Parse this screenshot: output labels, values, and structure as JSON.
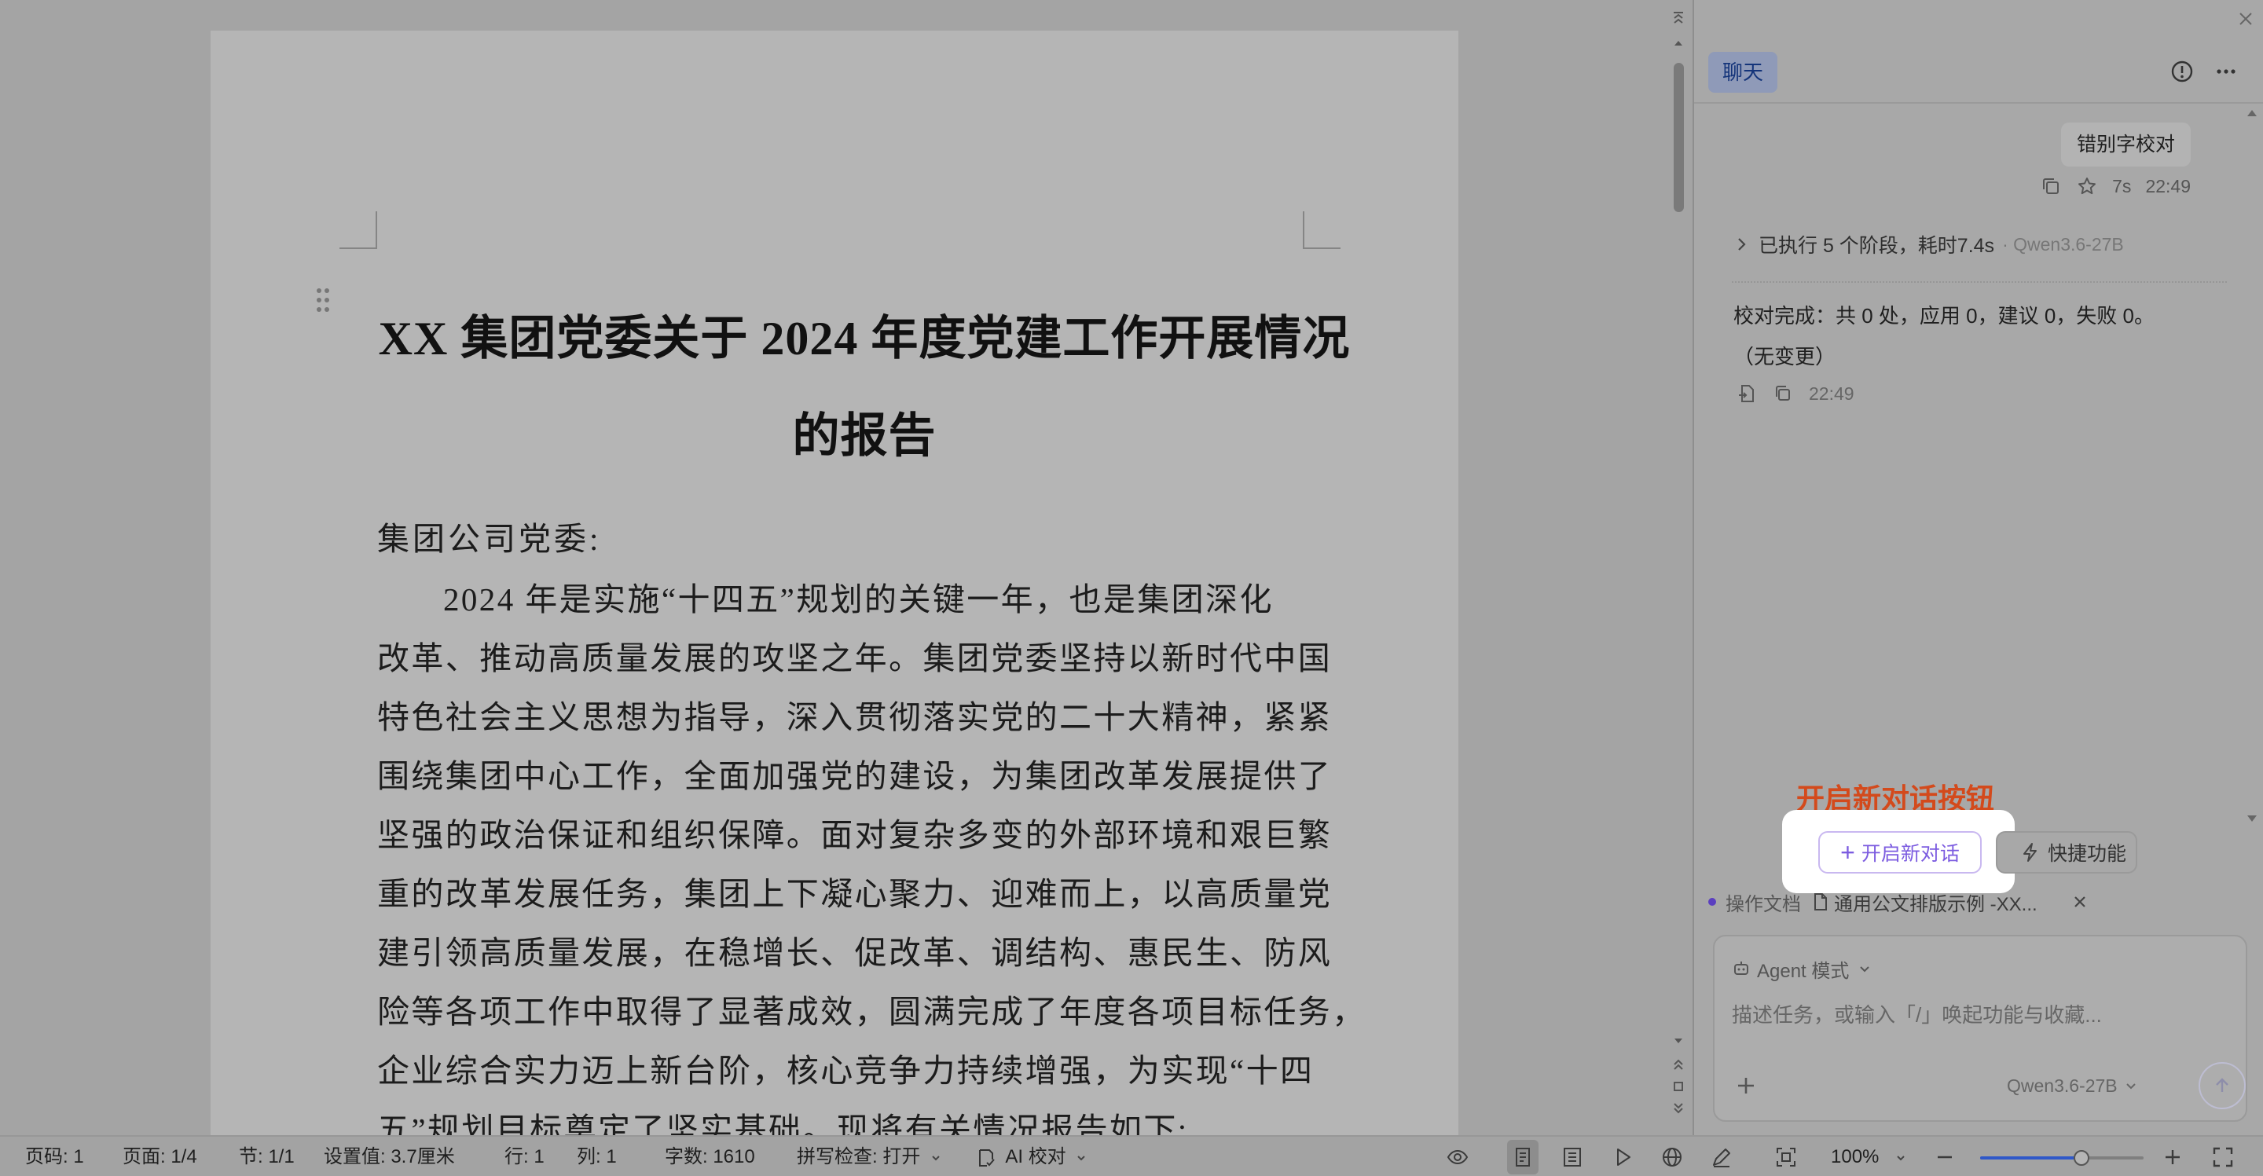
{
  "document": {
    "title_lines": [
      "XX 集团党委关于 2024 年度党建工作开展情况",
      "的报告"
    ],
    "salutation": "集团公司党委:",
    "body_lines": [
      "2024 年是实施“十四五”规划的关键一年，也是集团深化",
      "改革、推动高质量发展的攻坚之年。集团党委坚持以新时代中国",
      "特色社会主义思想为指导，深入贯彻落实党的二十大精神，紧紧",
      "围绕集团中心工作，全面加强党的建设，为集团改革发展提供了",
      "坚强的政治保证和组织保障。面对复杂多变的外部环境和艰巨繁",
      "重的改革发展任务，集团上下凝心聚力、迎难而上，以高质量党",
      "建引领高质量发展，在稳增长、促改革、调结构、惠民生、防风",
      "险等各项工作中取得了显著成效，圆满完成了年度各项目标任务，",
      "企业综合实力迈上新台阶，核心竞争力持续增强，为实现“十四",
      "五”规划目标奠定了坚实基础。现将有关情况报告如下:"
    ]
  },
  "panel": {
    "tab_chat": "聊天",
    "user_message": "错别字校对",
    "user_meta": {
      "duration": "7s",
      "time": "22:49"
    },
    "steps_summary": "已执行 5 个阶段，耗时7.4s",
    "steps_model": "· Qwen3.6-27B",
    "result_line1": "校对完成：共 0 处，应用 0，建议 0，失败 0。",
    "result_line2": "（无变更）",
    "result_time": "22:49",
    "annotation": "开启新对话按钮",
    "new_chat_label": "开启新对话",
    "quick_label": "快捷功能",
    "op_label": "操作文档",
    "op_file": "通用公文排版示例 -XX...",
    "agent_mode": "Agent 模式",
    "input_placeholder": "描述任务，或输入「/」唤起功能与收藏...",
    "model": "Qwen3.6-27B"
  },
  "statusbar": {
    "page_no": "页码: 1",
    "pages": "页面: 1/4",
    "section": "节: 1/1",
    "setting": "设置值: 3.7厘米",
    "row": "行: 1",
    "col": "列: 1",
    "word_count": "字数: 1610",
    "spell_check": "拼写检查: 打开",
    "ai_proof": "AI 校对",
    "zoom": "100%",
    "zoom_level": 0.62
  },
  "icons": [
    "drag-handle-icon",
    "close-icon",
    "info-icon",
    "more-icon",
    "copy-icon",
    "star-icon",
    "chevron-right-icon",
    "insert-doc-icon",
    "lightning-icon",
    "file-icon",
    "robot-icon",
    "plus-icon",
    "arrow-up-icon",
    "eye-icon",
    "page-view-icon",
    "outline-icon",
    "play-icon",
    "globe-icon",
    "pen-icon",
    "focus-icon",
    "zoom-out-icon",
    "zoom-in-icon",
    "fullscreen-icon"
  ],
  "colors": {
    "accent": "#7c5ce0",
    "annotation": "#d34a1c",
    "zoom_fill": "#2f58c8",
    "tab_chat_text": "#14347a"
  }
}
